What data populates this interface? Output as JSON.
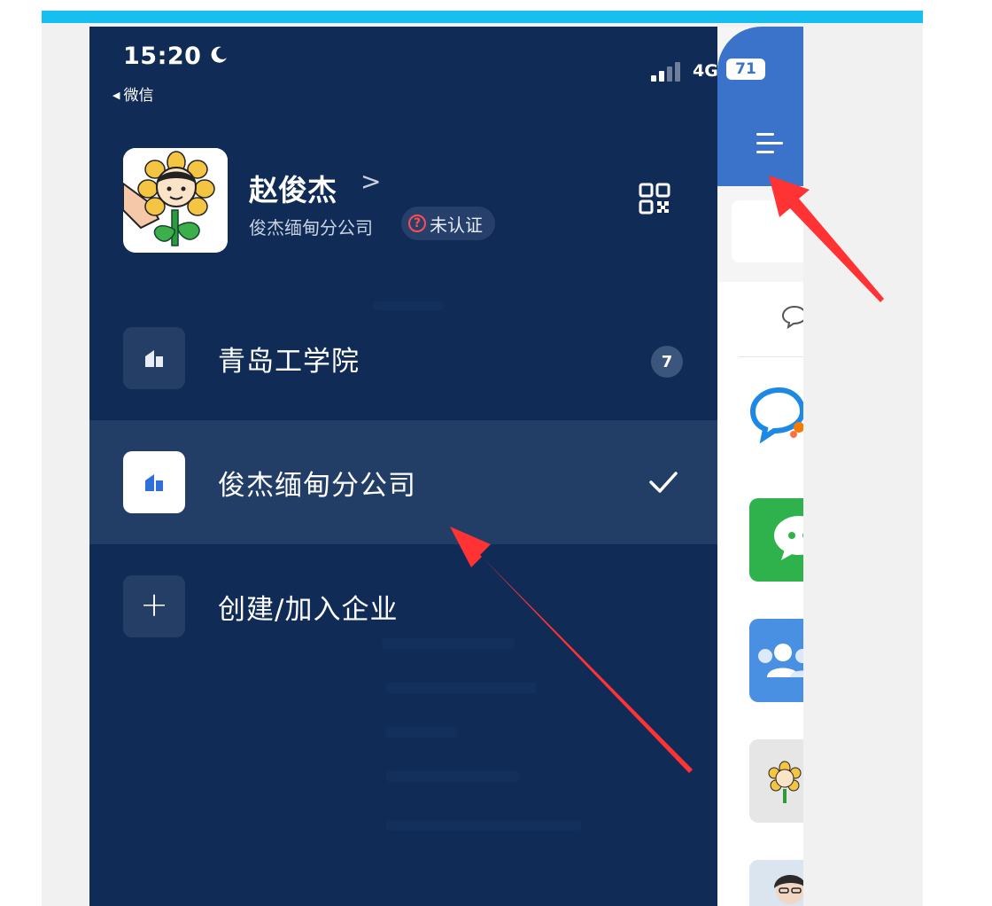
{
  "status_bar": {
    "time": "15:20",
    "back_label": "微信",
    "network": "4G",
    "battery": "71"
  },
  "profile": {
    "name": "赵俊杰",
    "chevron": ">",
    "company": "俊杰缅甸分公司",
    "cert_label": "未认证",
    "cert_icon": "?"
  },
  "orgs": [
    {
      "label": "青岛工学院",
      "badge": "7",
      "selected": false
    },
    {
      "label": "俊杰缅甸分公司",
      "selected": true
    },
    {
      "label": "创建/加入企业"
    }
  ],
  "colors": {
    "drawer_bg": "#0f2b56",
    "selected_row": "#223d66",
    "accent_blue": "#3a73c9",
    "top_bar": "#17bff0",
    "arrow_red": "#ff3333",
    "badge_red": "#ff4d4f"
  },
  "icons": [
    "moon-icon",
    "signal-icon",
    "qr-code-icon",
    "building-icon",
    "check-icon",
    "plus-icon",
    "menu-icon",
    "chat-bubble-icon",
    "wechat-icon",
    "group-icon"
  ]
}
